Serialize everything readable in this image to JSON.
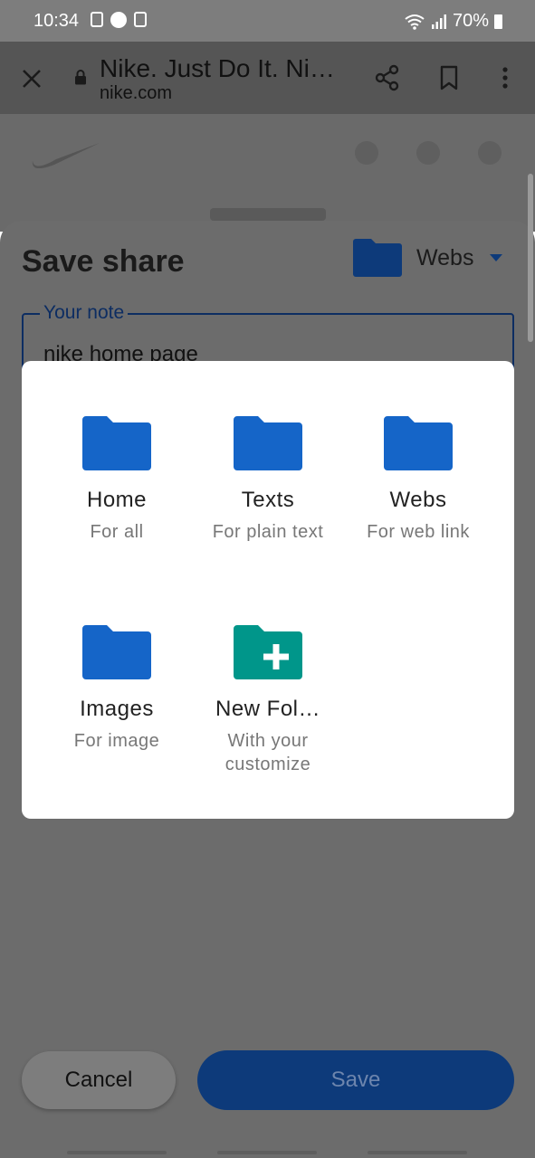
{
  "status": {
    "time": "10:34",
    "battery": "70%"
  },
  "browser": {
    "title": "Nike. Just Do It. Ni…",
    "url": "nike.com"
  },
  "sheet": {
    "title": "Save share",
    "selected_folder": "Webs",
    "note_label": "Your note",
    "note_value": "nike home page",
    "cancel_label": "Cancel",
    "save_label": "Save"
  },
  "folders": [
    {
      "name": "Home",
      "desc": "For all",
      "icon": "folder-icon"
    },
    {
      "name": "Texts",
      "desc": "For plain text",
      "icon": "folder-icon"
    },
    {
      "name": "Webs",
      "desc": "For web link",
      "icon": "folder-icon"
    },
    {
      "name": "Images",
      "desc": "For image",
      "icon": "folder-icon"
    },
    {
      "name": "New Fol…",
      "desc": "With your customize",
      "icon": "new-folder-icon"
    }
  ],
  "colors": {
    "folder": "#1565c8",
    "new_folder": "#00968a",
    "save_button": "#0d3a7a"
  }
}
